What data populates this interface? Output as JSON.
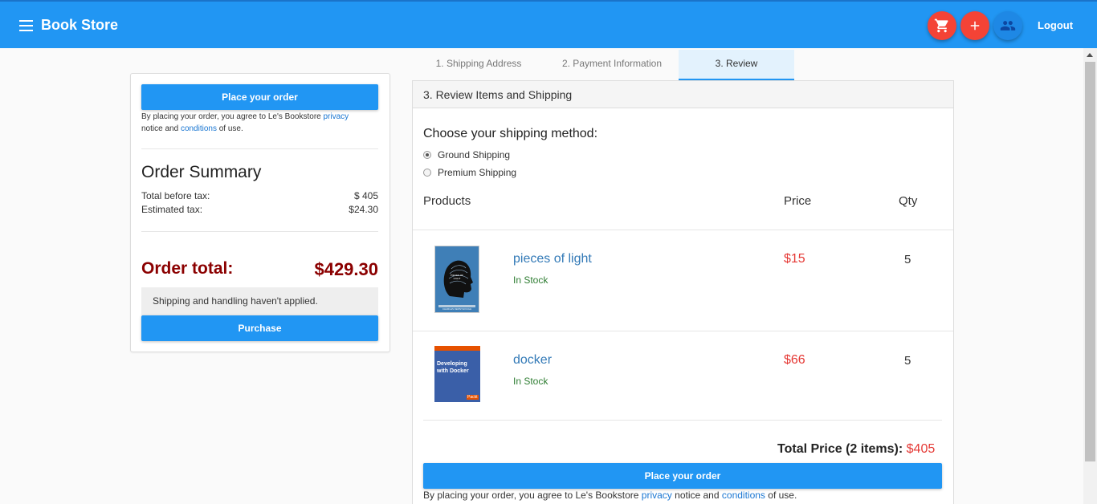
{
  "app": {
    "title": "Book Store",
    "logout": "Logout",
    "fab_icons": [
      "cart-icon",
      "plus-icon",
      "user-group-icon"
    ]
  },
  "tabs": [
    {
      "label": "1. Shipping Address",
      "active": false
    },
    {
      "label": "2. Payment Information",
      "active": false
    },
    {
      "label": "3. Review",
      "active": true
    }
  ],
  "summary": {
    "place_order": "Place your order",
    "agree_prefix": "By placing your order, you agree to Le's Bookstore",
    "privacy": "privacy",
    "notice_and": "notice and",
    "conditions": "conditions",
    "of_use": "of use.",
    "title": "Order Summary",
    "before_tax_label": "Total before tax:",
    "before_tax_value": "$ 405",
    "tax_label": "Estimated tax:",
    "tax_value": "$24.30",
    "total_label": "Order total:",
    "total_value": "$429.30",
    "shipping_note": "Shipping and handling haven't applied.",
    "purchase": "Purchase"
  },
  "review": {
    "header": "3. Review Items and Shipping",
    "shipping_title": "Choose your shipping method:",
    "shipping_options": [
      {
        "label": "Ground Shipping",
        "selected": true
      },
      {
        "label": "Premium Shipping",
        "selected": false
      }
    ],
    "columns": {
      "products": "Products",
      "price": "Price",
      "qty": "Qty"
    },
    "items": [
      {
        "title": "pieces of light",
        "stock": "In Stock",
        "price": "$15",
        "qty": "5",
        "cover_text": "PIECES OF LIGHT",
        "cover_author": "CHARLES FERNYHOUGH"
      },
      {
        "title": "docker",
        "stock": "In Stock",
        "price": "$66",
        "qty": "5",
        "cover_text": "Developing with Docker",
        "cover_brand": "Packt"
      }
    ],
    "total_label": "Total Price (2 items):",
    "total_value": "$405",
    "place_order": "Place your order",
    "agree_prefix": "By placing your order, you agree to Le's Bookstore",
    "privacy": "privacy",
    "notice_and": "notice and",
    "conditions": "conditions",
    "of_use": "of use."
  },
  "colors": {
    "primary": "#2196f3",
    "fab_red": "#f44336",
    "order_total": "#8b0000",
    "price": "#e53935",
    "in_stock": "#2e7d32"
  }
}
